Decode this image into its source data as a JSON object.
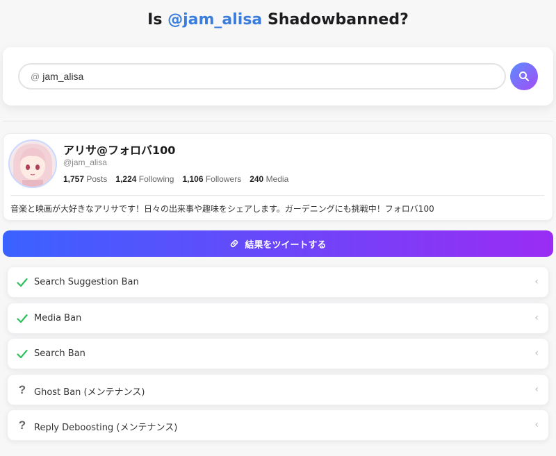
{
  "header": {
    "prefix": "Is",
    "handle": "@jam_alisa",
    "suffix": "Shadowbanned?"
  },
  "search": {
    "at_symbol": "@",
    "value": "jam_alisa",
    "placeholder": ""
  },
  "profile": {
    "display_name": "アリサ@フォロバ100",
    "username": "@jam_alisa",
    "stats": [
      {
        "count": "1,757",
        "label": "Posts"
      },
      {
        "count": "1,224",
        "label": "Following"
      },
      {
        "count": "1,106",
        "label": "Followers"
      },
      {
        "count": "240",
        "label": "Media"
      }
    ],
    "bio": "音楽と映画が大好きなアリサです！日々の出来事や趣味をシェアします。ガーデニングにも挑戦中！フォロバ100"
  },
  "tweet_button": {
    "label": "結果をツイートする",
    "icon": "link-icon"
  },
  "results": [
    {
      "label": "Search Suggestion Ban",
      "status": "pass",
      "status_symbol": "✓"
    },
    {
      "label": "Media Ban",
      "status": "pass",
      "status_symbol": "✓"
    },
    {
      "label": "Search Ban",
      "status": "pass",
      "status_symbol": "✓"
    },
    {
      "label": "Ghost Ban (メンテナンス)",
      "status": "unknown",
      "status_symbol": "?"
    },
    {
      "label": "Reply Deboosting (メンテナンス)",
      "status": "unknown",
      "status_symbol": "?"
    }
  ],
  "colors": {
    "handle": "#3b7ddd",
    "check": "#2cc05c",
    "gradient_start": "#3a62ff",
    "gradient_end": "#9a2cf4"
  }
}
